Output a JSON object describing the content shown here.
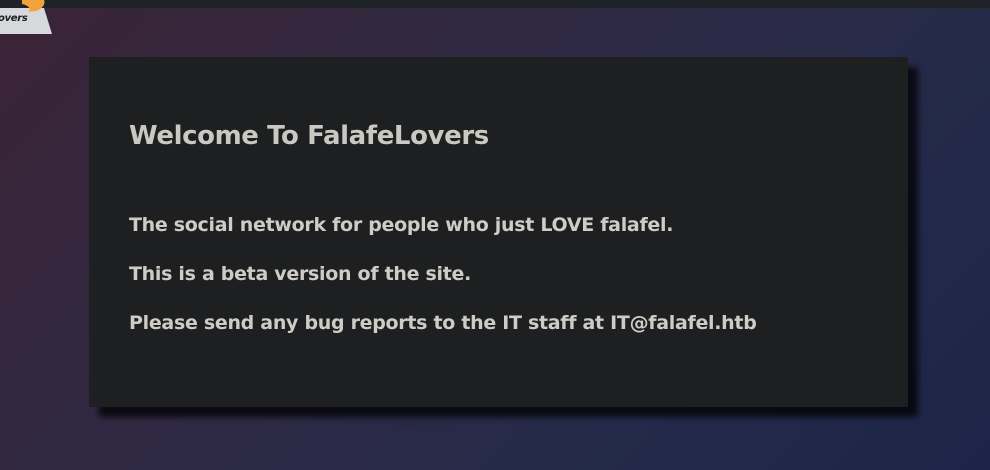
{
  "logo": {
    "text": "overs",
    "colors": {
      "badge": "#d7d8db",
      "accent": "#f2a23a"
    }
  },
  "page": {
    "colors": {
      "background_start": "#3b2336",
      "background_end": "#1c2548",
      "card": "#1e1f21",
      "text": "#cfccc6"
    }
  },
  "welcome": {
    "title": "Welcome To FalafeLovers",
    "lines": [
      "The social network for people who just LOVE falafel.",
      "This is a beta version of the site.",
      "Please send any bug reports to the IT staff at IT@falafel.htb"
    ]
  }
}
